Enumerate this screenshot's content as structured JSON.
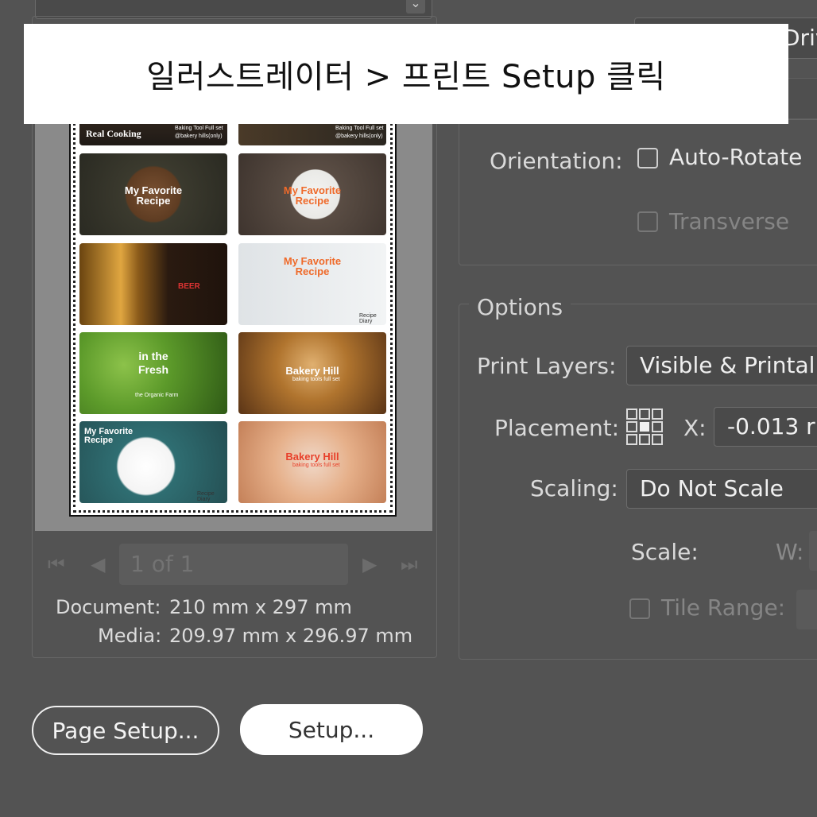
{
  "banner": {
    "text": "일러스트레이터 > 프린트 Setup 클릭"
  },
  "top": {
    "right_field_partial": "Driv"
  },
  "preview": {
    "tiles": [
      {
        "title": "Real Cooking",
        "sub": ""
      },
      {
        "title": "",
        "sub": "Baking Tool Full set"
      },
      {
        "title": "My Favorite Recipe",
        "sub": ""
      },
      {
        "title": "My Favorite Recipe",
        "sub": ""
      },
      {
        "title": "BEER",
        "sub": ""
      },
      {
        "title": "My Favorite Recipe",
        "sub": "Recipe Diary"
      },
      {
        "title": "in the Fresh",
        "sub": "the Organic Farm"
      },
      {
        "title": "Bakery Hill",
        "sub": "baking tools full set"
      },
      {
        "title": "My Favorite Recipe",
        "sub": "Recipe Diary"
      },
      {
        "title": "Bakery Hill",
        "sub": "baking tools full set"
      }
    ],
    "tile0_sub": "Baking Tool Full set",
    "tile0_sub2": "@bakery hills(only)",
    "tile1_sub2": "@bakery hills(only)",
    "page_indicator": "1 of 1",
    "document_label": "Document:",
    "document_value": "210 mm x 297 mm",
    "media_label": "Media:",
    "media_value": "209.97 mm x 296.97 mm"
  },
  "orientation": {
    "label": "Orientation:",
    "auto_rotate": "Auto-Rotate",
    "transverse": "Transverse"
  },
  "options": {
    "title": "Options",
    "print_layers_label": "Print Layers:",
    "print_layers_value": "Visible & Printal",
    "placement_label": "Placement:",
    "x_label": "X:",
    "x_value": "-0.013 r",
    "scaling_label": "Scaling:",
    "scaling_value": "Do Not Scale",
    "scale_label": "Scale:",
    "w_label": "W:",
    "tile_range_label": "Tile Range:"
  },
  "buttons": {
    "page_setup": "Page Setup...",
    "setup": "Setup..."
  }
}
